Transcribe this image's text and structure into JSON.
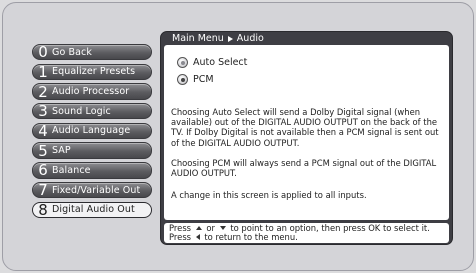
{
  "breadcrumb": {
    "root": "Main Menu",
    "current": "Audio"
  },
  "menu": {
    "items": [
      {
        "num": "0",
        "label": "Go Back"
      },
      {
        "num": "1",
        "label": "Equalizer Presets"
      },
      {
        "num": "2",
        "label": "Audio Processor"
      },
      {
        "num": "3",
        "label": "Sound Logic"
      },
      {
        "num": "4",
        "label": "Audio Language"
      },
      {
        "num": "5",
        "label": "SAP"
      },
      {
        "num": "6",
        "label": "Balance"
      },
      {
        "num": "7",
        "label": "Fixed/Variable Out"
      },
      {
        "num": "8",
        "label": "Digital Audio Out"
      }
    ],
    "selected_index": 8
  },
  "options": [
    {
      "label": "Auto Select",
      "selected": false
    },
    {
      "label": "PCM",
      "selected": true
    }
  ],
  "description": {
    "p1": "Choosing Auto Select will send a Dolby Digital signal (when available) out of the DIGITAL AUDIO OUTPUT on the back of the TV. If Dolby Digital is not available then a PCM signal is sent out of the DIGITAL AUDIO OUTPUT.",
    "p2": "Choosing PCM will always send a PCM signal out of the DIGITAL AUDIO OUTPUT.",
    "p3": "A change in this screen is applied to all inputs."
  },
  "hint": {
    "part1": "Press",
    "part2": "or",
    "part3": "to point to an option, then press OK to select it. Press",
    "part4": "to return to the menu."
  }
}
